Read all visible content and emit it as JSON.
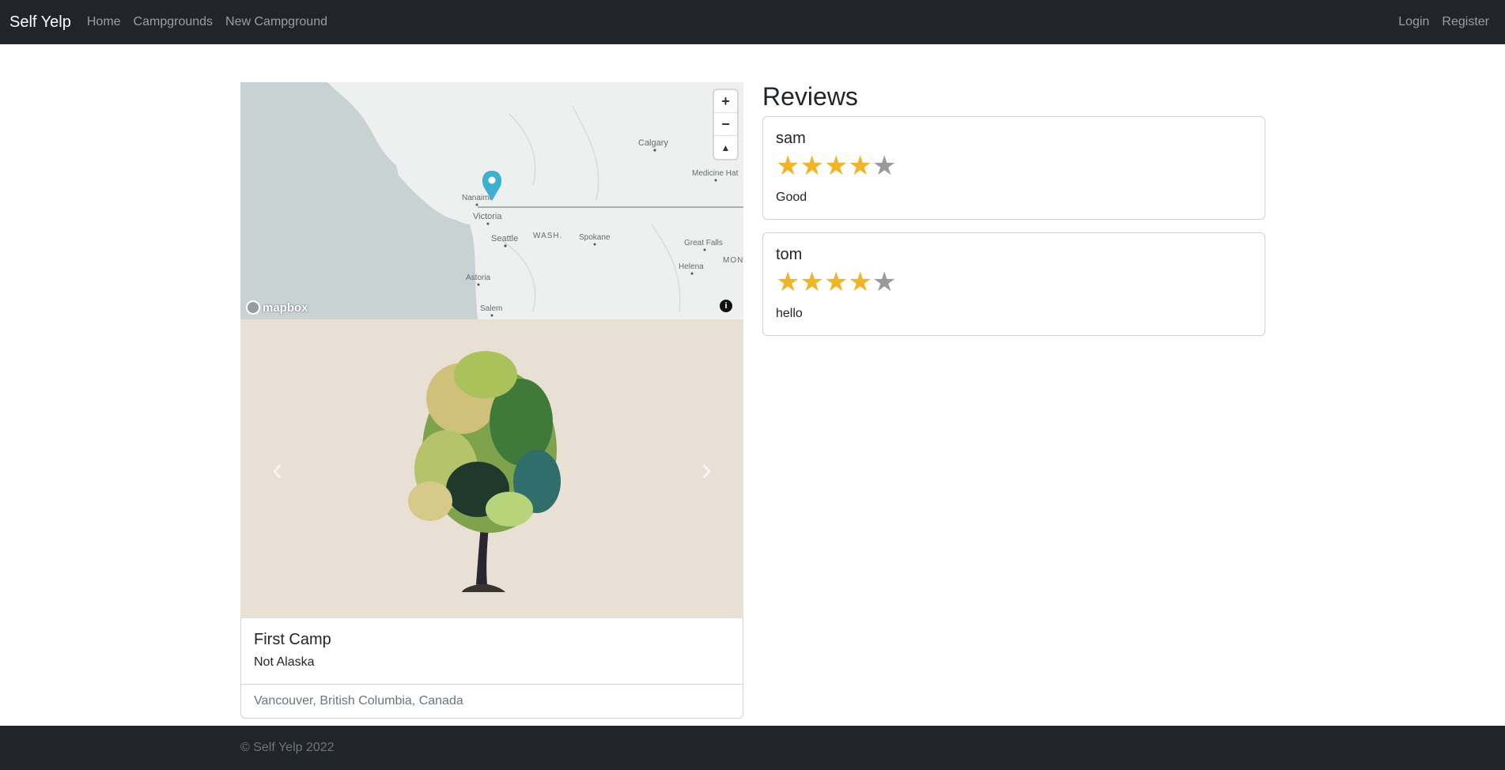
{
  "nav": {
    "brand": "Self Yelp",
    "links": [
      "Home",
      "Campgrounds",
      "New Campground"
    ],
    "right_links": [
      "Login",
      "Register"
    ]
  },
  "map": {
    "labels": [
      "Calgary",
      "Medicine Hat",
      "Nanaimo",
      "Victoria",
      "Seattle",
      "WASH.",
      "Spokane",
      "Great Falls",
      "Helena",
      "MONT",
      "Astoria",
      "Salem"
    ],
    "attribution": "mapbox",
    "zoom_in": "+",
    "zoom_out": "−",
    "compass": "▲",
    "info": "i"
  },
  "carousel": {
    "prev": "‹",
    "next": "›"
  },
  "campground": {
    "title": "First Camp",
    "description": "Not Alaska",
    "location": "Vancouver, British Columbia, Canada"
  },
  "reviews": {
    "heading": "Reviews",
    "items": [
      {
        "author": "sam",
        "rating": 4,
        "body": "Good"
      },
      {
        "author": "tom",
        "rating": 4,
        "body": "hello"
      }
    ]
  },
  "footer": {
    "text": "© Self Yelp 2022"
  },
  "colors": {
    "navbar": "#212529",
    "star_on": "#f0b429",
    "star_off": "#9a9a9a",
    "pin": "#3fb1ce"
  }
}
